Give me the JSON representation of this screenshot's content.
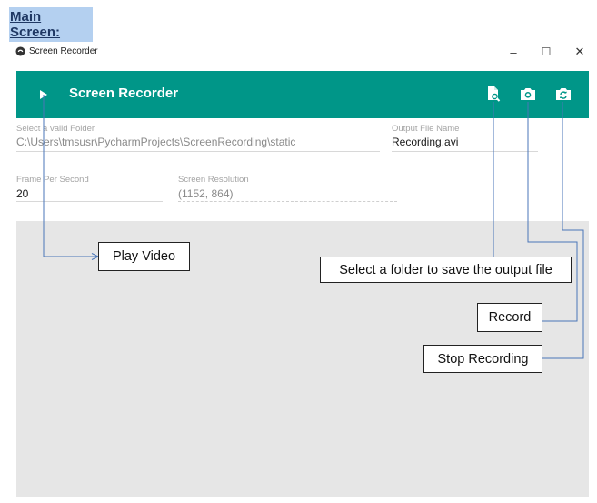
{
  "doc": {
    "heading": "Main Screen:"
  },
  "window": {
    "title": "Screen Recorder",
    "minimize": "–",
    "maximize": "☐",
    "close": "✕"
  },
  "toolbar": {
    "title": "Screen Recorder",
    "icons": [
      "play-icon",
      "folder-search-icon",
      "camera-icon",
      "camera-switch-icon"
    ],
    "color": "#009688"
  },
  "form": {
    "folder_label": "Select a valid Folder",
    "folder_value": "C:\\Users\\tmsusr\\PycharmProjects\\ScreenRecording\\static",
    "output_label": "Output File Name",
    "output_value": "Recording.avi",
    "fps_label": "Frame Per Second",
    "fps_value": "20",
    "resolution_label": "Screen Resolution",
    "resolution_value": "(1152, 864)"
  },
  "callouts": {
    "play": "Play Video",
    "folder": "Select a folder to save the output file",
    "record": "Record",
    "stop": "Stop Recording"
  }
}
